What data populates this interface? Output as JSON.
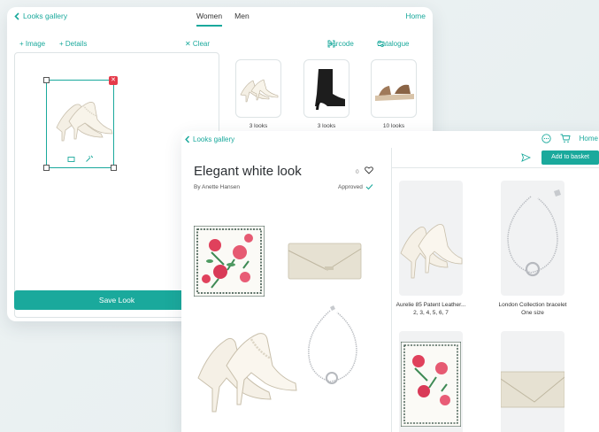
{
  "back_window": {
    "back_label": "Looks gallery",
    "tabs": [
      {
        "label": "Women"
      },
      {
        "label": "Men"
      }
    ],
    "home_label": "Home",
    "toolbar": {
      "image_label": "+ Image",
      "details_label": "+ Details",
      "clear_label": "✕ Clear",
      "barcode_label": "Barcode",
      "catalogue_label": "Catalogue"
    },
    "save_label": "Save Look",
    "products": [
      {
        "label": "3 looks"
      },
      {
        "label": "3 looks"
      },
      {
        "label": "10 looks"
      }
    ]
  },
  "front_window": {
    "back_label": "Looks gallery",
    "home_label": "Home",
    "title": "Elegant white look",
    "author": "By Anette Hansen",
    "like_count": "0",
    "status": "Approved",
    "add_to_basket": "Add to basket",
    "items": [
      {
        "name": "Aurelie 85 Patent Leather...",
        "sizes": "2, 3, 4, 5, 6, 7"
      },
      {
        "name": "London Collection bracelet",
        "sizes": "One size"
      }
    ]
  },
  "colors": {
    "accent": "#1aa99c",
    "delete": "#e53b4a"
  }
}
